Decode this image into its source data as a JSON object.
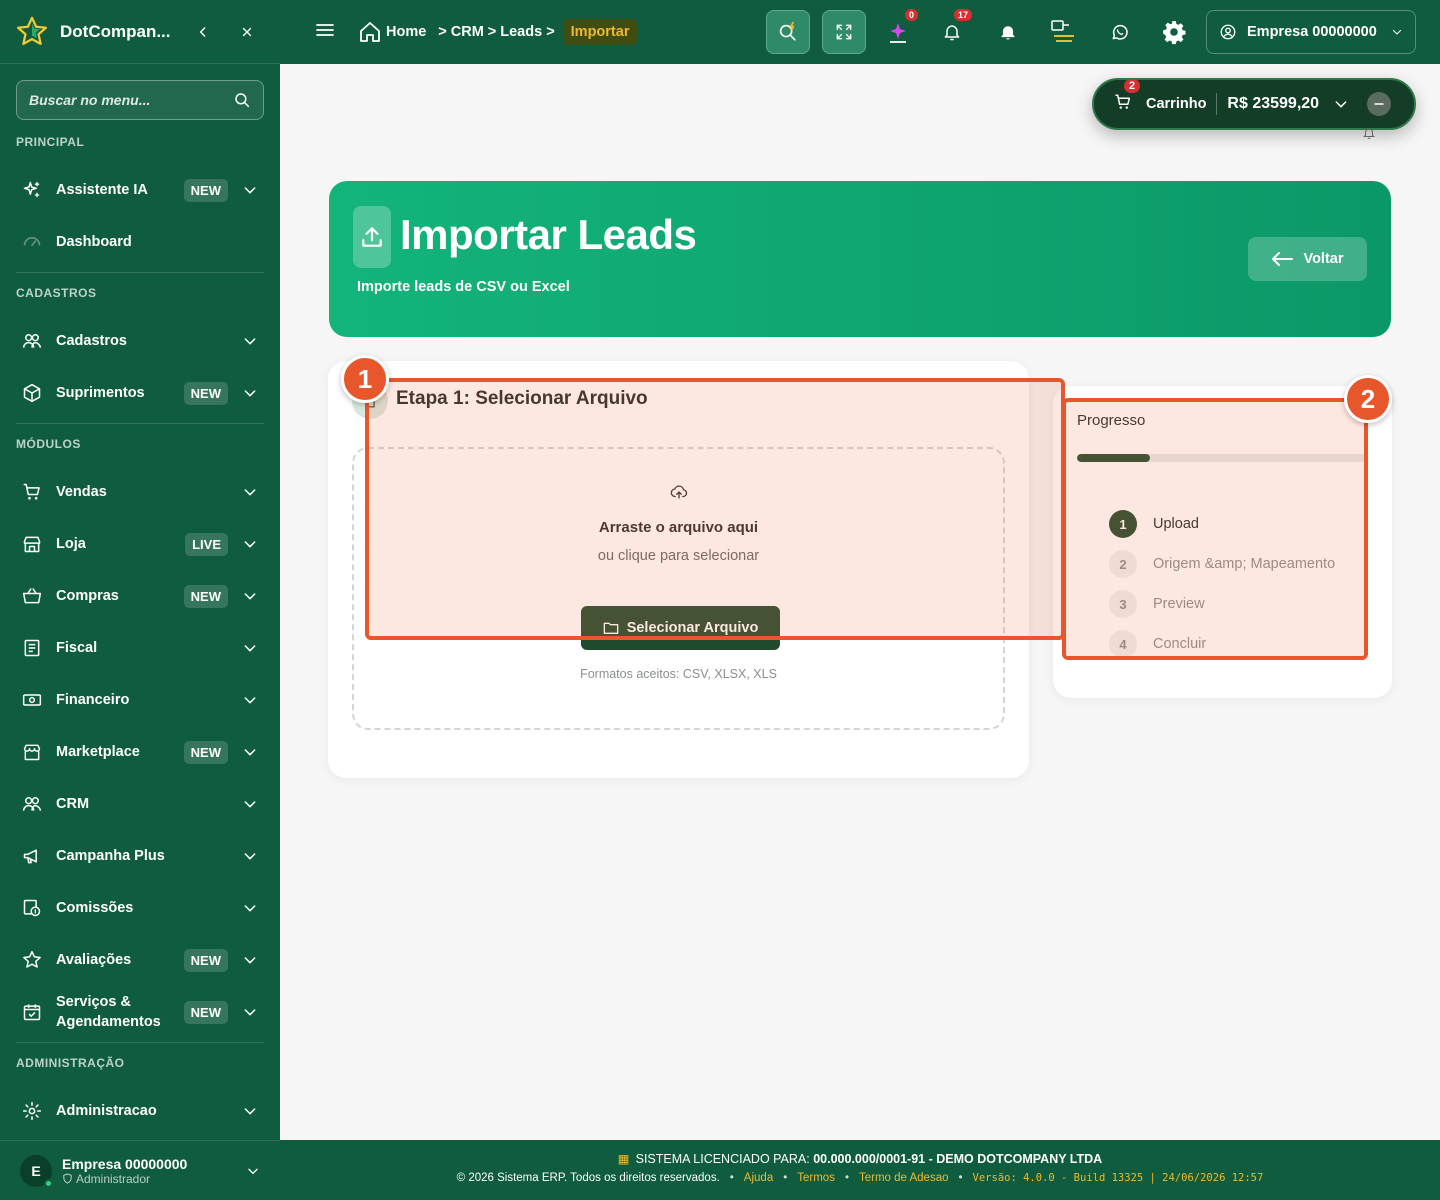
{
  "app": {
    "name": "DotCompan..."
  },
  "sidebar": {
    "search_placeholder": "Buscar no menu...",
    "sections": {
      "principal": "PRINCIPAL",
      "cadastros": "CADASTROS",
      "modulos": "MÓDULOS",
      "administracao": "ADMINISTRAÇÃO"
    },
    "items": {
      "assistente": {
        "label": "Assistente IA",
        "badge": "NEW"
      },
      "dashboard": {
        "label": "Dashboard"
      },
      "cadastros": {
        "label": "Cadastros"
      },
      "suprimentos": {
        "label": "Suprimentos",
        "badge": "NEW"
      },
      "vendas": {
        "label": "Vendas"
      },
      "loja": {
        "label": "Loja",
        "badge": "LIVE"
      },
      "compras": {
        "label": "Compras",
        "badge": "NEW"
      },
      "fiscal": {
        "label": "Fiscal"
      },
      "financeiro": {
        "label": "Financeiro"
      },
      "marketplace": {
        "label": "Marketplace",
        "badge": "NEW"
      },
      "crm": {
        "label": "CRM"
      },
      "campanha": {
        "label": "Campanha Plus"
      },
      "comissoes": {
        "label": "Comissões"
      },
      "avaliacoes": {
        "label": "Avaliações",
        "badge": "NEW"
      },
      "servicos": {
        "label_line1": "Serviços &",
        "label_line2": "Agendamentos",
        "badge": "NEW"
      },
      "administracao": {
        "label": "Administracao"
      }
    },
    "user": {
      "initial": "E",
      "name": "Empresa 00000000",
      "role": "Administrador"
    }
  },
  "topbar": {
    "breadcrumb": {
      "home": "Home",
      "crm": "CRM",
      "leads": "Leads",
      "current": "Importar"
    },
    "ai_badge": "0",
    "notifications_badge": "17",
    "company": "Empresa 00000000"
  },
  "cart": {
    "count": "2",
    "label": "Carrinho",
    "total": "R$ 23599,20"
  },
  "hero": {
    "title": "Importar Leads",
    "subtitle": "Importe leads de CSV ou Excel",
    "back_label": "Voltar"
  },
  "upload": {
    "step_title": "Etapa 1: Selecionar Arquivo",
    "drop_title": "Arraste o arquivo aqui",
    "drop_sub": "ou clique para selecionar",
    "button": "Selecionar Arquivo",
    "formats": "Formatos aceitos: CSV, XLSX, XLS"
  },
  "progress": {
    "title": "Progresso",
    "fraction": 0.25,
    "steps": [
      {
        "num": "1",
        "label": "Upload",
        "active": true
      },
      {
        "num": "2",
        "label": "Origem &amp; Mapeamento",
        "active": false
      },
      {
        "num": "3",
        "label": "Preview",
        "active": false
      },
      {
        "num": "4",
        "label": "Concluir",
        "active": false
      }
    ]
  },
  "annotations": {
    "one": "1",
    "two": "2"
  },
  "footer": {
    "license_prefix": "SISTEMA LICENCIADO PARA:",
    "license_value": "00.000.000/0001-91 - DEMO DOTCOMPANY LTDA",
    "copyright": "© 2026 Sistema ERP. Todos os direitos reservados.",
    "links": {
      "ajuda": "Ajuda",
      "termos": "Termos",
      "adesao": "Termo de Adesao"
    },
    "version": "Versão: 4.0.0 - Build 13325 | 24/06/2026 12:57"
  },
  "colors": {
    "primary": "#0f5c3e",
    "accent": "#f0b92b",
    "annotation": "#e8572b",
    "hero": "#13b47a"
  }
}
